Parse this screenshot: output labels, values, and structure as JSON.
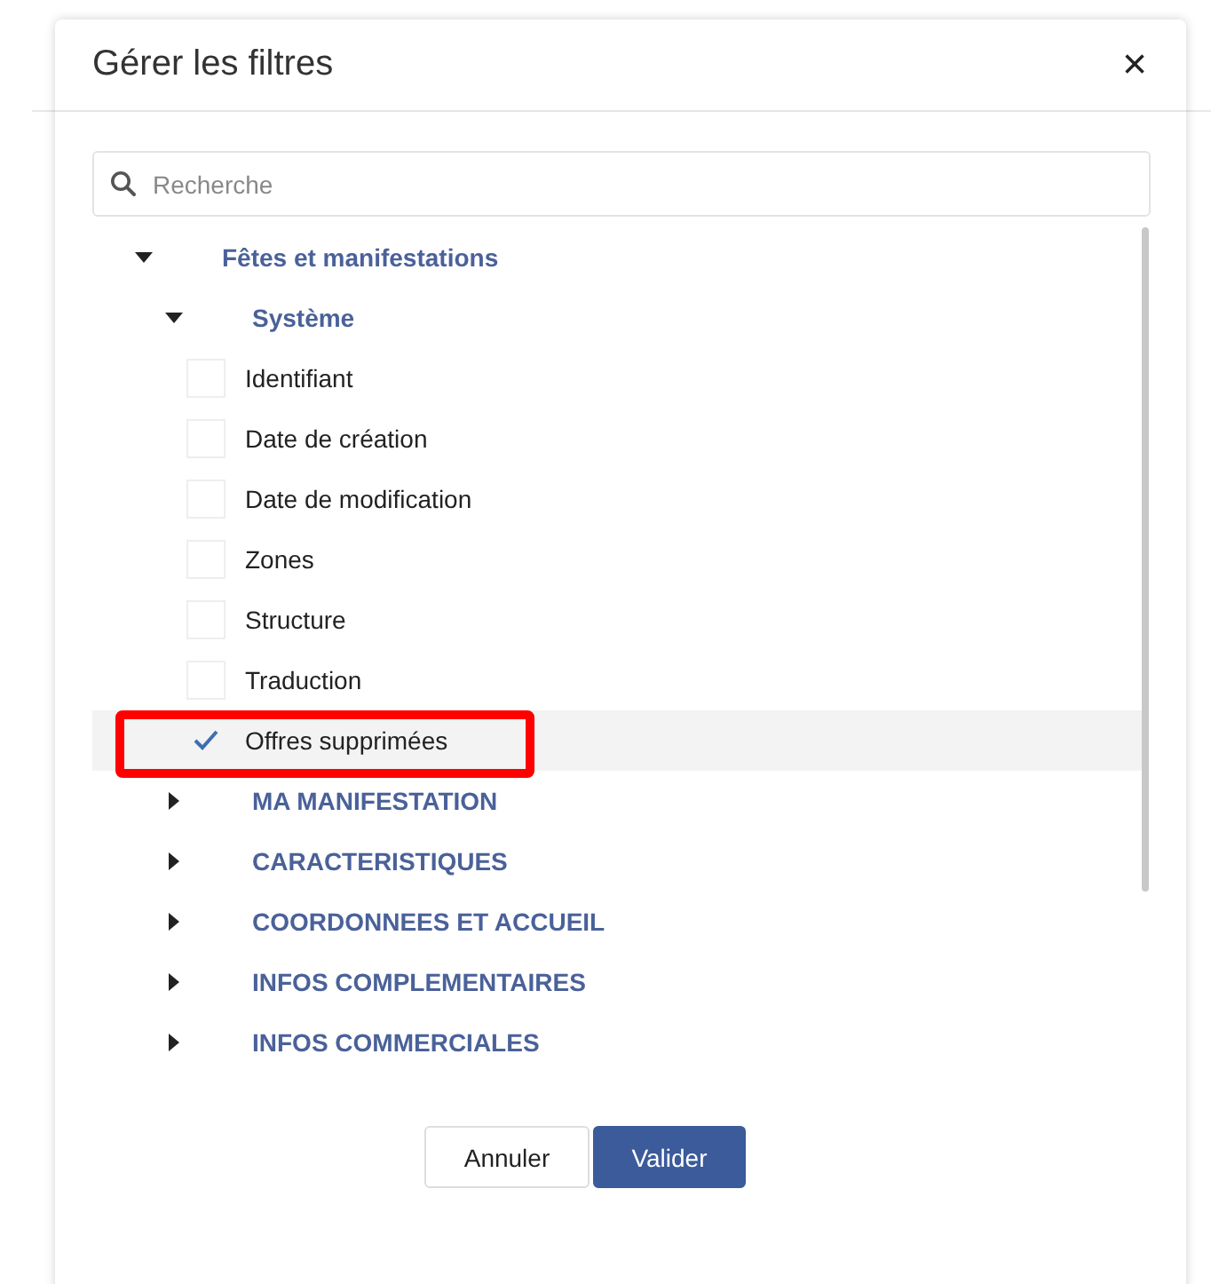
{
  "dialog": {
    "title": "Gérer les filtres",
    "close_icon": "×"
  },
  "search": {
    "placeholder": "Recherche"
  },
  "tree": [
    {
      "label": "Fêtes et manifestations",
      "kind": "group",
      "expanded": true,
      "children": [
        {
          "label": "Système",
          "kind": "group",
          "expanded": true,
          "children": [
            {
              "label": "Identifiant",
              "kind": "field",
              "checked": false,
              "highlighted": false,
              "annotated": false
            },
            {
              "label": "Date de création",
              "kind": "field",
              "checked": false,
              "highlighted": false,
              "annotated": false
            },
            {
              "label": "Date de modification",
              "kind": "field",
              "checked": false,
              "highlighted": false,
              "annotated": false
            },
            {
              "label": "Zones",
              "kind": "field",
              "checked": false,
              "highlighted": false,
              "annotated": false
            },
            {
              "label": "Structure",
              "kind": "field",
              "checked": false,
              "highlighted": false,
              "annotated": false
            },
            {
              "label": "Traduction",
              "kind": "field",
              "checked": false,
              "highlighted": false,
              "annotated": false
            },
            {
              "label": "Offres supprimées",
              "kind": "field",
              "checked": true,
              "highlighted": true,
              "annotated": true
            }
          ]
        },
        {
          "label": "MA MANIFESTATION",
          "kind": "group",
          "expanded": false
        },
        {
          "label": "CARACTERISTIQUES",
          "kind": "group",
          "expanded": false
        },
        {
          "label": "COORDONNEES ET ACCUEIL",
          "kind": "group",
          "expanded": false
        },
        {
          "label": "INFOS COMPLEMENTAIRES",
          "kind": "group",
          "expanded": false
        },
        {
          "label": "INFOS COMMERCIALES",
          "kind": "group",
          "expanded": false
        }
      ]
    }
  ],
  "buttons": [
    {
      "label": "Annuler",
      "kind": "secondary"
    },
    {
      "label": "Valider",
      "kind": "primary"
    }
  ]
}
